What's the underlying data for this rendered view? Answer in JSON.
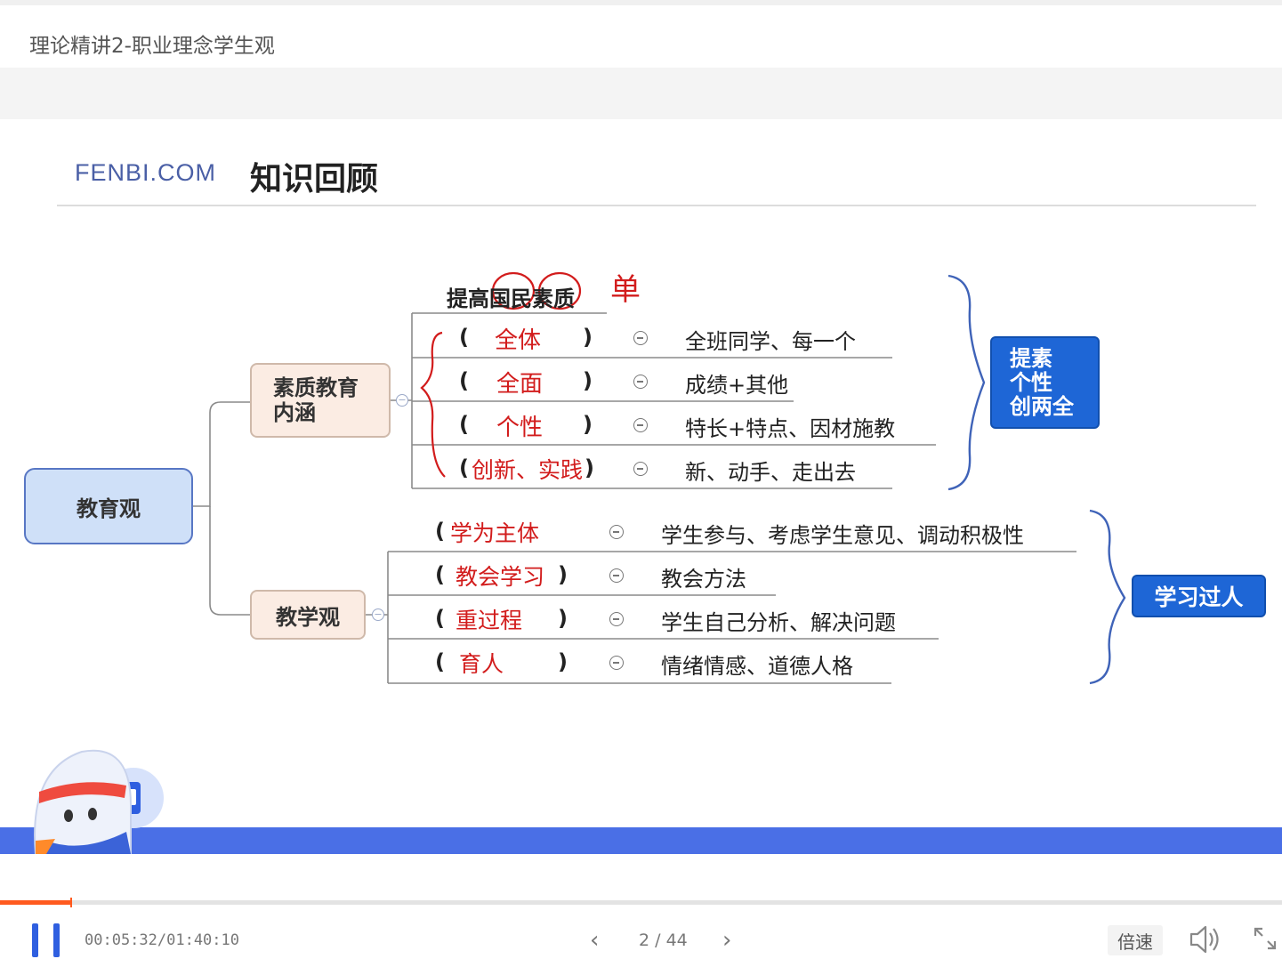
{
  "window": {
    "title": "理论精讲2-职业理念学生观"
  },
  "slide": {
    "brand": "FENBI.COM",
    "heading": "知识回顾",
    "root": "教育观",
    "branch1": {
      "label": "素质教育内涵",
      "top": "提高国民素质",
      "top_note": "单",
      "rows": [
        {
          "answer": "全体",
          "desc": "全班同学、每一个"
        },
        {
          "answer": "全面",
          "desc": "成绩+其他"
        },
        {
          "answer": "个性",
          "desc": "特长+特点、因材施教"
        },
        {
          "answer": "创新、实践",
          "desc": "新、动手、走出去"
        }
      ],
      "summary": [
        "提素",
        "个性",
        "创两全"
      ]
    },
    "branch2": {
      "label": "教学观",
      "rows": [
        {
          "answer": "学为主体",
          "desc": "学生参与、考虑学生意见、调动积极性"
        },
        {
          "answer": "教会学习",
          "desc": "教会方法"
        },
        {
          "answer": "重过程",
          "desc": "学生自己分析、解决问题"
        },
        {
          "answer": "育人",
          "desc": "情绪情感、道德人格"
        }
      ],
      "summary": "学习过人"
    },
    "paren_open": "(",
    "paren_close": ")"
  },
  "player": {
    "time": "00:05:32/01:40:10",
    "progress": 0.055,
    "pages": "2 / 44",
    "prev_icon": "chevron-left-icon",
    "next_icon": "chevron-right-icon",
    "speed": "倍速",
    "volume_icon": "speaker-icon",
    "fullscreen_icon": "fullscreen-icon"
  },
  "colors": {
    "accent": "#2f5fe0",
    "progress": "#ff5a1f",
    "handwriting": "#d21c1c",
    "summary_box": "#1e66d6"
  }
}
